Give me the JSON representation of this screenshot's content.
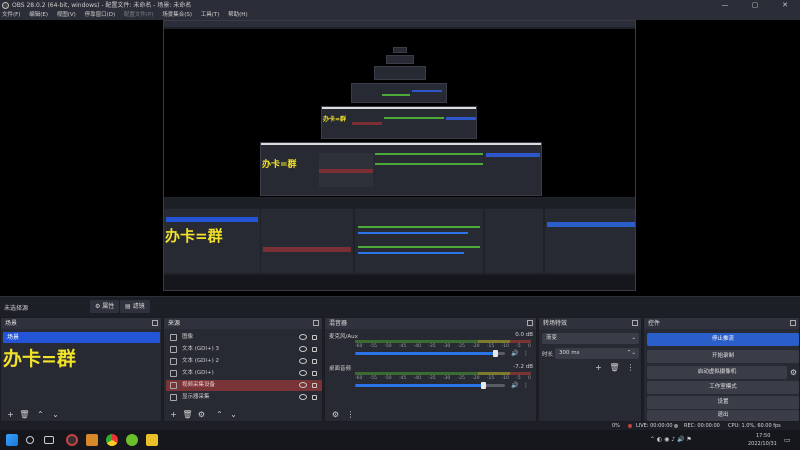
{
  "window": {
    "title": "OBS 28.0.2 (64-bit, windows) - 配置文件: 未命名 - 场景: 未命名"
  },
  "menu": [
    {
      "label": "文件(F)",
      "enabled": true
    },
    {
      "label": "编辑(E)",
      "enabled": true
    },
    {
      "label": "视图(V)",
      "enabled": true
    },
    {
      "label": "停靠窗口(D)",
      "enabled": true
    },
    {
      "label": "配置文件(P)",
      "enabled": false
    },
    {
      "label": "场景集合(S)",
      "enabled": true
    },
    {
      "label": "工具(T)",
      "enabled": true
    },
    {
      "label": "帮助(H)",
      "enabled": true
    }
  ],
  "scene_bar": {
    "current_scene": "未选择源",
    "properties_label": "属性",
    "filters_label": "滤镜"
  },
  "watermark_text": "办卡=群",
  "scenes": {
    "header": "场景",
    "items": [
      "场景"
    ]
  },
  "sources": {
    "header": "来源",
    "items": [
      {
        "label": "图像",
        "icon": "image-icon",
        "selected": false
      },
      {
        "label": "文本 (GDI+) 3",
        "icon": "text-icon",
        "selected": false
      },
      {
        "label": "文本 (GDI+) 2",
        "icon": "text-icon",
        "selected": false
      },
      {
        "label": "文本 (GDI+)",
        "icon": "text-icon",
        "selected": false
      },
      {
        "label": "视频采集设备",
        "icon": "camera-icon",
        "selected": true
      },
      {
        "label": "显示器采集",
        "icon": "monitor-icon",
        "selected": false
      }
    ]
  },
  "mixer": {
    "header": "混音器",
    "channels": [
      {
        "name": "麦克风/Aux",
        "db": "0.0 dB",
        "volume": 0.93
      },
      {
        "name": "桌面音频",
        "db": "-7.2 dB",
        "volume": 0.85
      }
    ],
    "ticks": [
      "-60",
      "-55",
      "-50",
      "-45",
      "-40",
      "-35",
      "-30",
      "-25",
      "-20",
      "-15",
      "-10",
      "-5",
      "0"
    ]
  },
  "transitions": {
    "header": "转场特效",
    "type": "渐变",
    "duration_label": "时长",
    "duration_value": "300 ms"
  },
  "controls": {
    "header": "控件",
    "buttons": [
      {
        "label": "停止推流",
        "primary": true
      },
      {
        "label": "开始录制",
        "primary": false
      },
      {
        "label": "启动虚拟摄像机",
        "primary": false
      },
      {
        "label": "工作室模式",
        "primary": false
      },
      {
        "label": "设置",
        "primary": false
      },
      {
        "label": "退出",
        "primary": false
      }
    ]
  },
  "status": {
    "dropped": "0%",
    "live": "LIVE: 00:00:00",
    "rec": "REC: 00:00:00",
    "cpu": "CPU: 1.0%, 60.00 fps"
  },
  "taskbar": {
    "time": "17:50",
    "date": "2022/10/31"
  },
  "colors": {
    "accent": "#2a5ec9",
    "selected_source": "#7a3438",
    "panel": "#272a33",
    "background": "#1d1f26"
  }
}
